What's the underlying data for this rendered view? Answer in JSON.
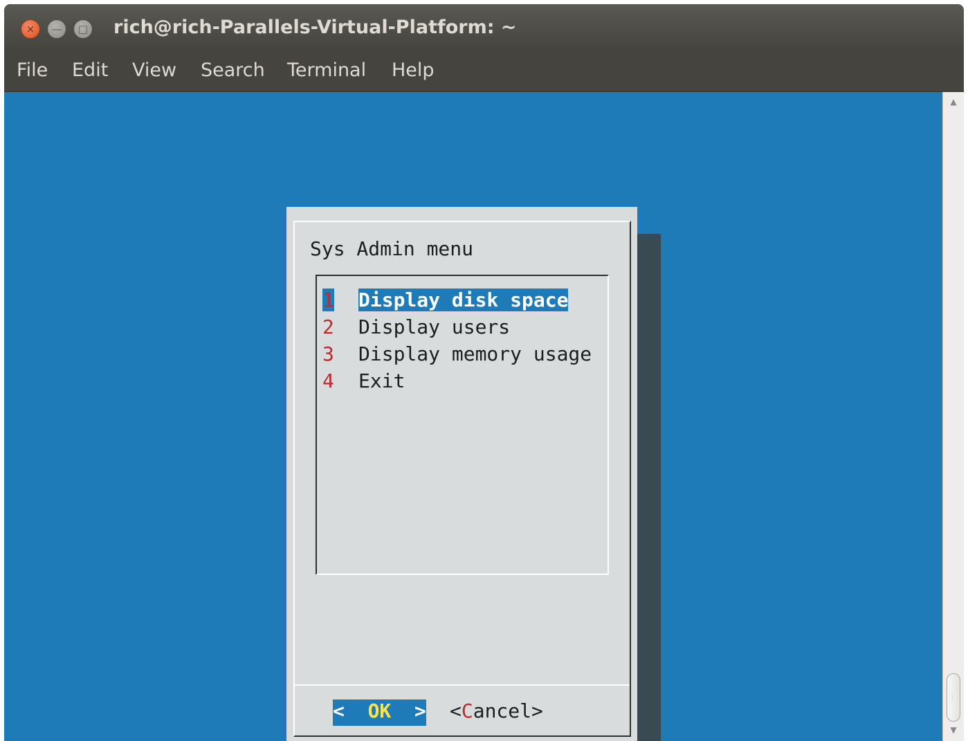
{
  "window": {
    "title": "rich@rich-Parallels-Virtual-Platform: ~",
    "close_glyph": "×",
    "minimize_glyph": "—",
    "maximize_glyph": "□"
  },
  "menubar": {
    "items": [
      "File",
      "Edit",
      "View",
      "Search",
      "Terminal",
      "Help"
    ]
  },
  "dialog": {
    "title": "Sys Admin menu",
    "items": [
      {
        "tag": "1",
        "label": "Display disk space",
        "selected": true
      },
      {
        "tag": "2",
        "label": "Display users",
        "selected": false
      },
      {
        "tag": "3",
        "label": "Display memory usage",
        "selected": false
      },
      {
        "tag": "4",
        "label": "Exit",
        "selected": false
      }
    ],
    "ok": {
      "left": "<",
      "label": "OK",
      "right": ">"
    },
    "cancel": {
      "open": "<",
      "hotkey": "C",
      "rest": "ancel",
      "close": ">"
    }
  },
  "colors": {
    "terminal_bg": "#1e7bb8",
    "dialog_bg": "#d8dcdc",
    "hotkey_red": "#c0282a",
    "ok_yellow": "#ffe34d"
  },
  "icons": {
    "close": "close-icon",
    "minimize": "minimize-icon",
    "maximize": "maximize-icon",
    "scroll_up": "scroll-up-arrow-icon",
    "scroll_down": "scroll-down-arrow-icon"
  }
}
